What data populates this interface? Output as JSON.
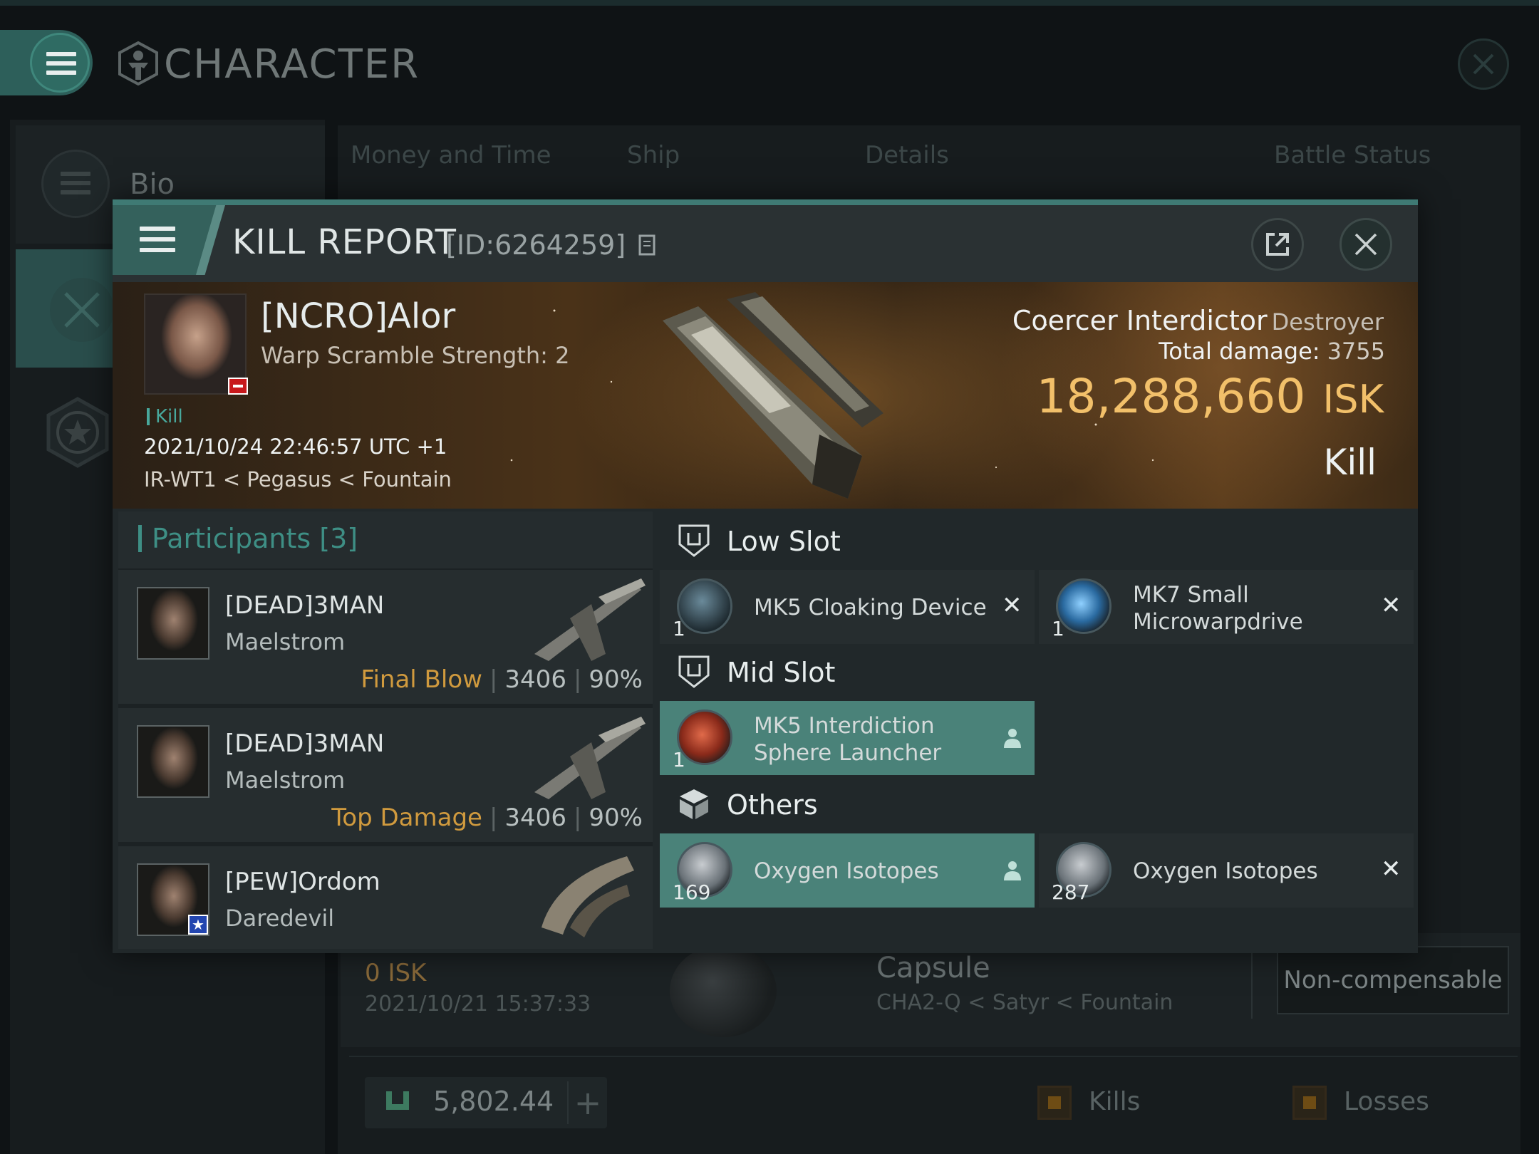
{
  "app": {
    "title": "CHARACTER",
    "sidebar": {
      "bio_label": "Bio"
    },
    "tabs": [
      "Money and Time",
      "Ship",
      "Details",
      "Battle Status"
    ],
    "background_row": {
      "isk": "0  ISK",
      "date": "2021/10/21  15:37:33",
      "ship": "Capsule",
      "location": "CHA2-Q < Satyr < Fountain",
      "status": "Non-compensable"
    },
    "footer": {
      "wallet": "5,802.44",
      "plus": "+",
      "legend_kills": "Kills",
      "legend_losses": "Losses"
    }
  },
  "kill_report": {
    "title": "KILL REPORT",
    "id": "[ID:6264259]",
    "pilot": {
      "name": "[NCRO]Alor",
      "warp_scramble": "Warp Scramble Strength: 2",
      "tag": "Kill",
      "time": "2021/10/24 22:46:57 UTC +1",
      "location": "IR-WT1 < Pegasus < Fountain"
    },
    "victim": {
      "ship": "Coercer Interdictor",
      "class": "Destroyer",
      "total_damage_label": "Total damage:",
      "total_damage": "3755",
      "isk": "18,288,660",
      "isk_unit": "ISK",
      "outcome": "Kill"
    },
    "participants": {
      "title": "Participants [3]",
      "rows": [
        {
          "name": "[DEAD]3MAN",
          "ship": "Maelstrom",
          "label": "Final Blow",
          "damage": "3406",
          "percent": "90%"
        },
        {
          "name": "[DEAD]3MAN",
          "ship": "Maelstrom",
          "label": "Top Damage",
          "damage": "3406",
          "percent": "90%"
        },
        {
          "name": "[PEW]Ordom",
          "ship": "Daredevil"
        }
      ]
    },
    "slots": {
      "low": {
        "title": "Low Slot",
        "items": [
          {
            "qty": "1",
            "name": "MK5 Cloaking Device"
          },
          {
            "qty": "1",
            "name": "MK7 Small Microwarpdrive"
          }
        ]
      },
      "mid": {
        "title": "Mid Slot",
        "items": [
          {
            "qty": "1",
            "name": "MK5 Interdiction Sphere Launcher"
          }
        ]
      },
      "others": {
        "title": "Others",
        "items": [
          {
            "qty": "169",
            "name": "Oxygen Isotopes"
          },
          {
            "qty": "287",
            "name": "Oxygen Isotopes"
          }
        ]
      }
    }
  },
  "colors": {
    "accent": "#3f7a74",
    "isk_gold": "#f2c06a",
    "final_blow": "#d09a3e",
    "active_item": "#4a8279"
  },
  "icons": [
    "hamburger-icon",
    "character-icon",
    "close-icon",
    "external-link-icon",
    "star-icon",
    "slot-icon",
    "cube-icon",
    "person-icon"
  ]
}
